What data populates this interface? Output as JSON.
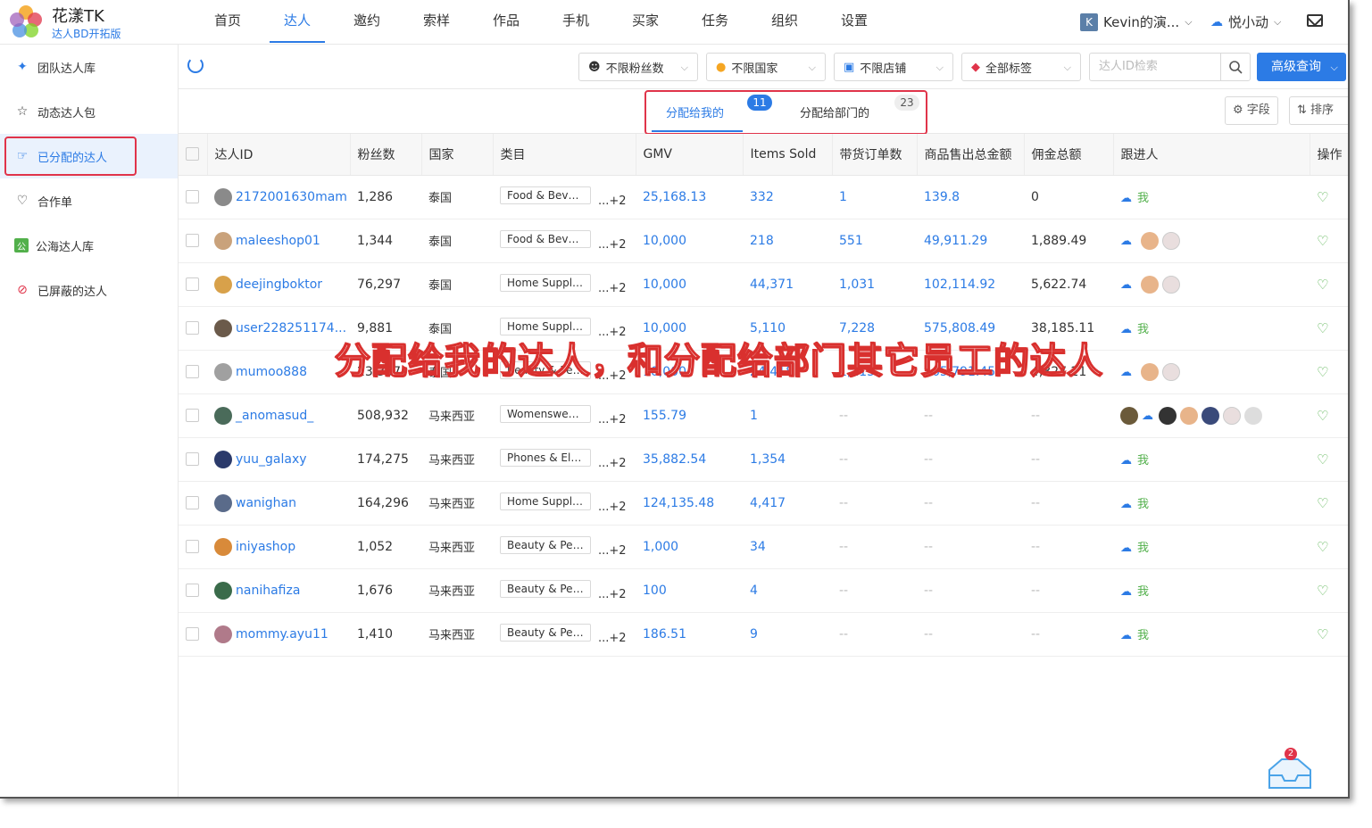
{
  "brand": {
    "name": "花漾TK",
    "subtitle": "达人BD开拓版"
  },
  "nav": [
    "首页",
    "达人",
    "邀约",
    "索样",
    "作品",
    "手机",
    "买家",
    "任务",
    "组织",
    "设置"
  ],
  "nav_active": "达人",
  "user": {
    "initial": "K",
    "name": "Kevin的演...",
    "company": "悦小动"
  },
  "sidebar": [
    {
      "label": "团队达人库",
      "icon": "bird-icon"
    },
    {
      "label": "动态达人包",
      "icon": "star-icon"
    },
    {
      "label": "已分配的达人",
      "icon": "hand-icon"
    },
    {
      "label": "合作单",
      "icon": "handshake-icon"
    },
    {
      "label": "公海达人库",
      "icon": "public-icon"
    },
    {
      "label": "已屏蔽的达人",
      "icon": "block-icon"
    }
  ],
  "filters": {
    "fans": "不限粉丝数",
    "country": "不限国家",
    "shop": "不限店铺",
    "tags": "全部标签",
    "search_placeholder": "达人ID检索",
    "advanced": "高级查询"
  },
  "tabs": {
    "mine": {
      "label": "分配给我的",
      "count": "11"
    },
    "dept": {
      "label": "分配给部门的",
      "count": "23"
    },
    "fields": "字段",
    "sort": "排序"
  },
  "columns": [
    "达人ID",
    "粉丝数",
    "国家",
    "类目",
    "GMV",
    "Items Sold",
    "带货订单数",
    "商品售出总金额",
    "佣金总额",
    "跟进人",
    "操作"
  ],
  "rows": [
    {
      "id": "2172001630mam",
      "fans": "1,286",
      "country": "泰国",
      "cat": "Food & Beve...",
      "more": "...+2",
      "gmv": "25,168.13",
      "sold": "332",
      "orders": "1",
      "sales": "139.8",
      "comm": "0",
      "follow": "me"
    },
    {
      "id": "maleeshop01",
      "fans": "1,344",
      "country": "泰国",
      "cat": "Food & Beve...",
      "more": "...+2",
      "gmv": "10,000",
      "sold": "218",
      "orders": "551",
      "sales": "49,911.29",
      "comm": "1,889.49",
      "follow": "avatars"
    },
    {
      "id": "deejingboktor",
      "fans": "76,297",
      "country": "泰国",
      "cat": "Home Supplies",
      "more": "...+2",
      "gmv": "10,000",
      "sold": "44,371",
      "orders": "1,031",
      "sales": "102,114.92",
      "comm": "5,622.74",
      "follow": "avatars"
    },
    {
      "id": "user228251174...",
      "fans": "9,881",
      "country": "泰国",
      "cat": "Home Supplies",
      "more": "...+2",
      "gmv": "10,000",
      "sold": "5,110",
      "orders": "7,228",
      "sales": "575,808.49",
      "comm": "38,185.11",
      "follow": "me"
    },
    {
      "id": "mumoo888",
      "fans": "23,367",
      "country": "泰国",
      "cat": "Beauty & Per...",
      "more": "...+2",
      "gmv": "10,000",
      "sold": "24,418",
      "orders": "1,115",
      "sales": "165,791.45",
      "comm": "4,327.21",
      "follow": "avatars"
    },
    {
      "id": "_anomasud_",
      "fans": "508,932",
      "country": "马来西亚",
      "cat": "Womenswea...",
      "more": "...+2",
      "gmv": "155.79",
      "sold": "1",
      "orders": "--",
      "sales": "--",
      "comm": "--",
      "follow": "many"
    },
    {
      "id": "yuu_galaxy",
      "fans": "174,275",
      "country": "马来西亚",
      "cat": "Phones & Ele...",
      "more": "...+2",
      "gmv": "35,882.54",
      "sold": "1,354",
      "orders": "--",
      "sales": "--",
      "comm": "--",
      "follow": "me"
    },
    {
      "id": "wanighan",
      "fans": "164,296",
      "country": "马来西亚",
      "cat": "Home Supplies",
      "more": "...+2",
      "gmv": "124,135.48",
      "sold": "4,417",
      "orders": "--",
      "sales": "--",
      "comm": "--",
      "follow": "me"
    },
    {
      "id": "iniyashop",
      "fans": "1,052",
      "country": "马来西亚",
      "cat": "Beauty & Per...",
      "more": "...+2",
      "gmv": "1,000",
      "sold": "34",
      "orders": "--",
      "sales": "--",
      "comm": "--",
      "follow": "me"
    },
    {
      "id": "nanihafiza",
      "fans": "1,676",
      "country": "马来西亚",
      "cat": "Beauty & Per...",
      "more": "...+2",
      "gmv": "100",
      "sold": "4",
      "orders": "--",
      "sales": "--",
      "comm": "--",
      "follow": "me"
    },
    {
      "id": "mommy.ayu11",
      "fans": "1,410",
      "country": "马来西亚",
      "cat": "Beauty & Per...",
      "more": "...+2",
      "gmv": "186.51",
      "sold": "9",
      "orders": "--",
      "sales": "--",
      "comm": "--",
      "follow": "me"
    }
  ],
  "me_label": "我",
  "overlay_text": "分配给我的达人，和分配给部门其它员工的达人",
  "notification_count": "2",
  "colors": {
    "accent": "#2c7be5",
    "highlight": "#e0344a",
    "me": "#52b04b"
  }
}
